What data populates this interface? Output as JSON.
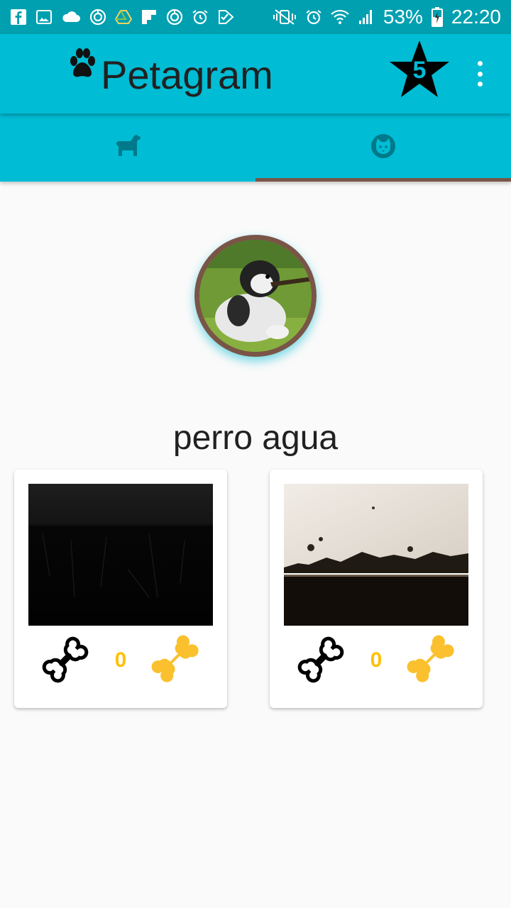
{
  "status_bar": {
    "left_icons": [
      "facebook-icon",
      "gallery-icon",
      "cloud-icon",
      "sync-icon",
      "drive-icon",
      "flipboard-icon",
      "sync-icon",
      "alarm-icon",
      "checkmark-icon"
    ],
    "right_icons": [
      "mute-vibrate-icon",
      "alarm-icon",
      "wifi-icon",
      "signal-icon"
    ],
    "battery": "53%",
    "time": "22:20"
  },
  "app_bar": {
    "title": "Petagram",
    "logo_icon": "paw-icon",
    "rating_badge": "5",
    "menu_icon": "more-vert-icon"
  },
  "tabs": [
    {
      "icon": "dog-icon",
      "selected": false
    },
    {
      "icon": "cat-face-icon",
      "selected": true
    }
  ],
  "profile": {
    "name": "perro agua"
  },
  "photos": [
    {
      "likes": "0",
      "like_icon": "bone-outline-icon",
      "fav_icon": "bone-gold-icon"
    },
    {
      "likes": "0",
      "like_icon": "bone-outline-icon",
      "fav_icon": "bone-gold-icon"
    }
  ],
  "colors": {
    "status_bar": "#00a0b0",
    "primary": "#00bcd4",
    "tab_indicator": "#795548",
    "like_count": "#ffc107",
    "background": "#fafafa"
  }
}
